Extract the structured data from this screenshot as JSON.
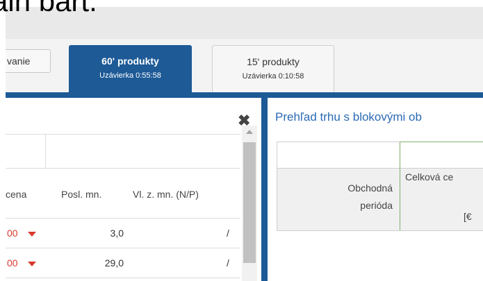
{
  "top": {
    "clipped_text": "ain bart."
  },
  "tabs": [
    {
      "label": "vanie"
    },
    {
      "label": "60' produkty",
      "sub": "Uzávierka 0:55:58"
    },
    {
      "label": "15' produkty",
      "sub": "Uzávierka 0:10:58"
    }
  ],
  "left_panel": {
    "headers": [
      "cena",
      "Posl. mn.",
      "Vl. z. mn. (N/P)"
    ],
    "rows": [
      {
        "price": "00",
        "qty": "3,0",
        "np": "/"
      },
      {
        "price": "00",
        "qty": "29,0",
        "np": "/"
      }
    ],
    "close_glyph": "✖"
  },
  "right_panel": {
    "title": "Prehľad trhu s blokovými ob",
    "col1": "Obchodná\nperióda",
    "col2": "Celková ce",
    "col2_unit": "[€"
  },
  "colors": {
    "accent": "#1d5a96",
    "down": "#d83a2e",
    "link": "#2a6ab5"
  }
}
